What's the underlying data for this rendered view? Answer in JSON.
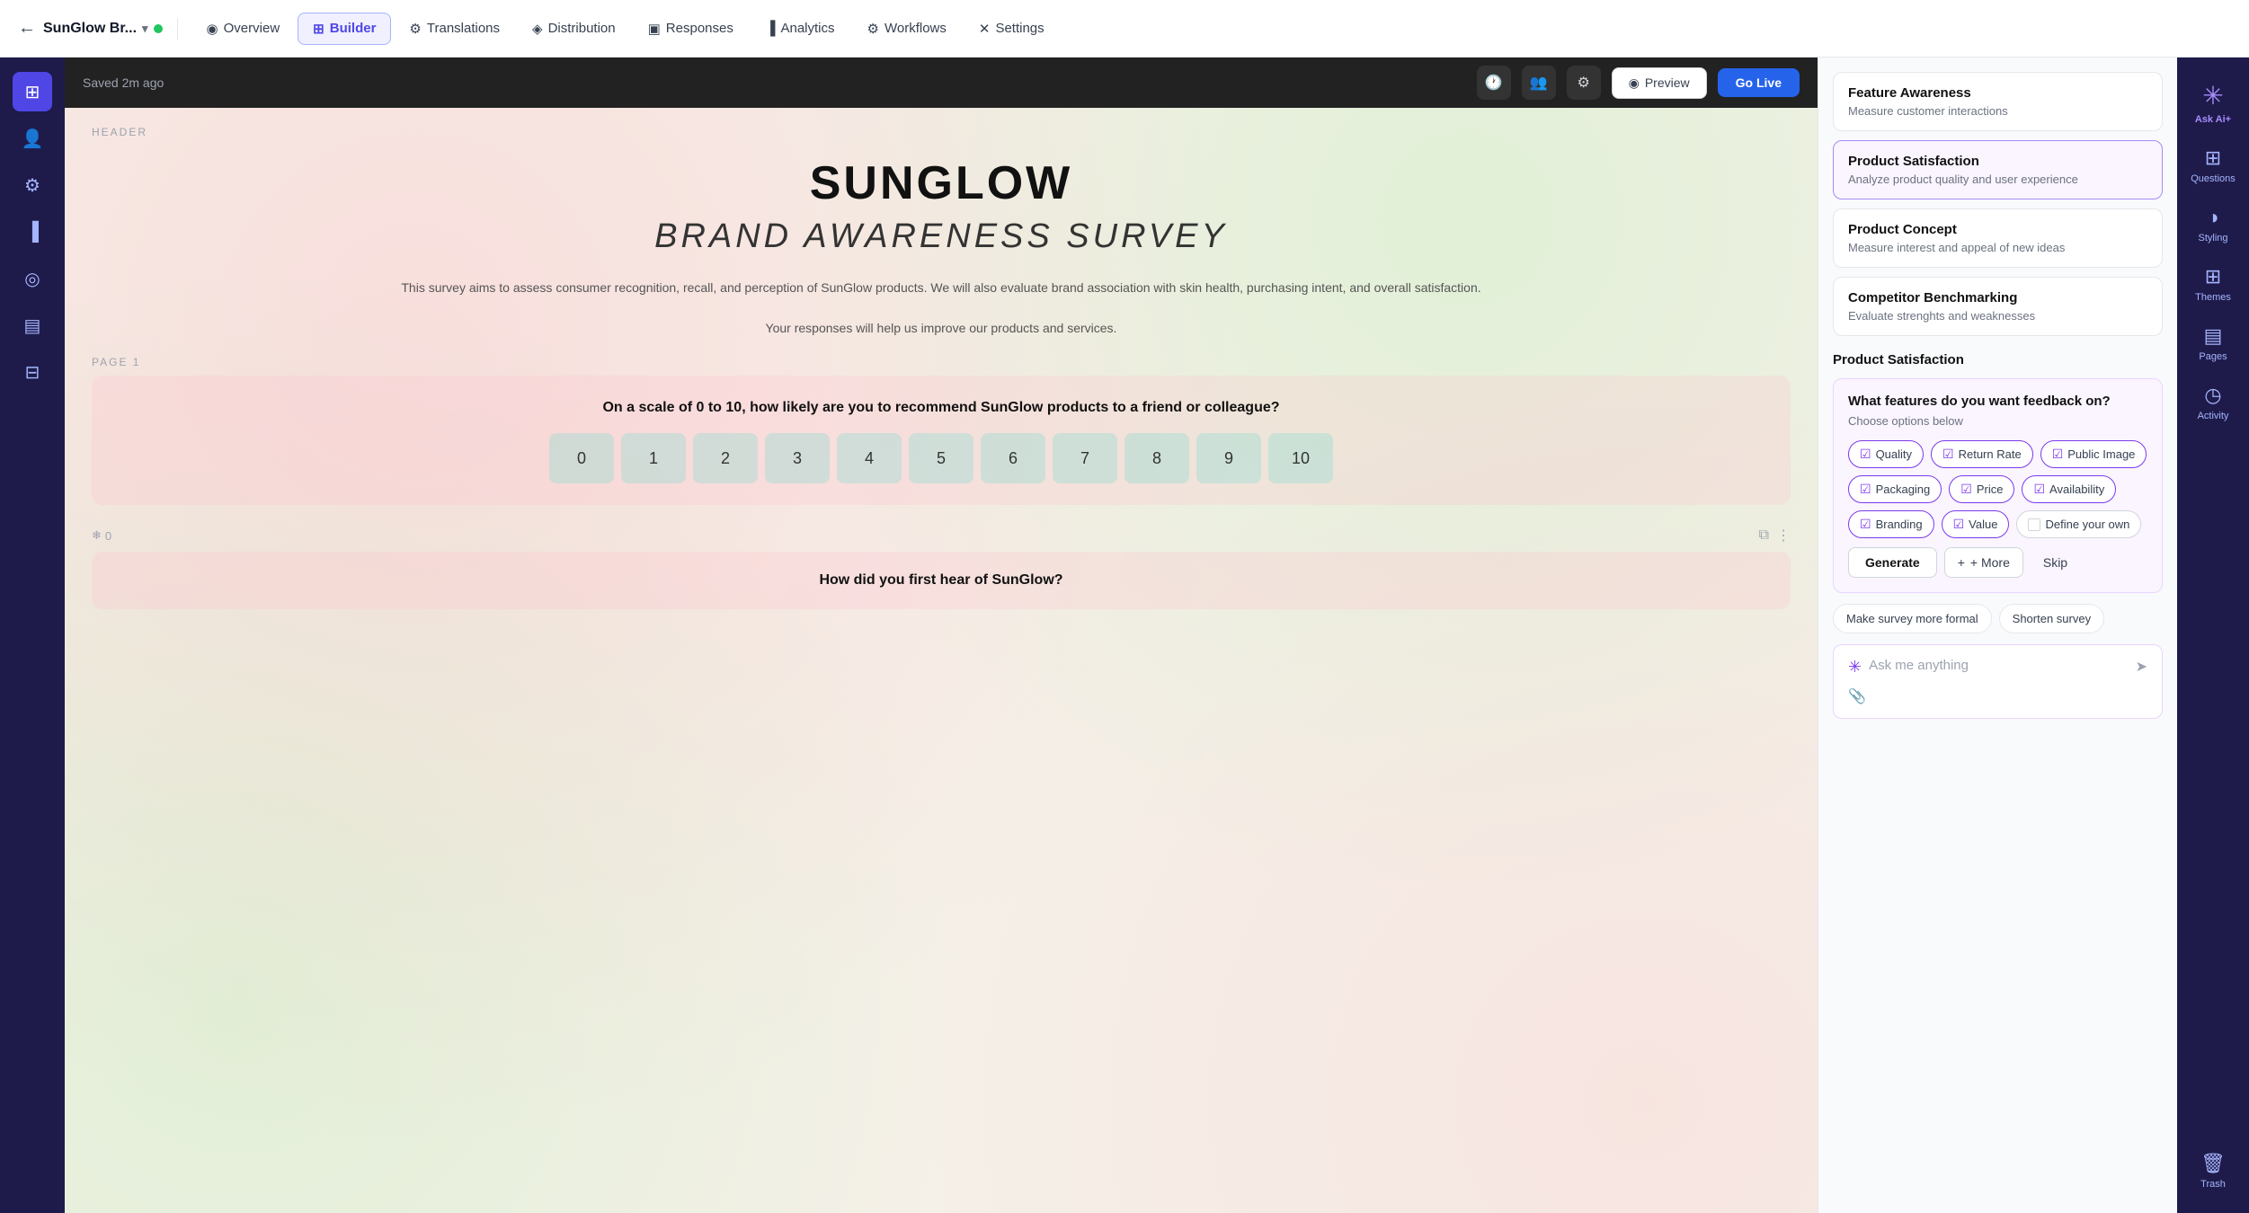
{
  "app": {
    "brand_name": "SunGlow Br...",
    "status_dot_color": "#22c55e",
    "saved_text": "Saved 2m ago"
  },
  "top_nav": {
    "back_label": "←",
    "tabs": [
      {
        "id": "overview",
        "label": "Overview",
        "icon": "◉",
        "active": false
      },
      {
        "id": "builder",
        "label": "Builder",
        "icon": "⊞",
        "active": true
      },
      {
        "id": "translations",
        "label": "Translations",
        "icon": "⚙",
        "active": false
      },
      {
        "id": "distribution",
        "label": "Distribution",
        "icon": "◈",
        "active": false
      },
      {
        "id": "responses",
        "label": "Responses",
        "icon": "▣",
        "active": false
      },
      {
        "id": "analytics",
        "label": "Analytics",
        "icon": "▐",
        "active": false
      },
      {
        "id": "workflows",
        "label": "Workflows",
        "icon": "⚙",
        "active": false
      },
      {
        "id": "settings",
        "label": "Settings",
        "icon": "✕",
        "active": false
      }
    ],
    "preview_label": "Preview",
    "golive_label": "Go Live"
  },
  "left_sidebar": {
    "icons": [
      {
        "id": "home",
        "symbol": "⊞",
        "active": true
      },
      {
        "id": "user",
        "symbol": "👤",
        "active": false
      },
      {
        "id": "settings",
        "symbol": "⚙",
        "active": false
      },
      {
        "id": "chart",
        "symbol": "▐",
        "active": false
      },
      {
        "id": "record",
        "symbol": "◎",
        "active": false
      },
      {
        "id": "doc",
        "symbol": "▤",
        "active": false
      },
      {
        "id": "inbox",
        "symbol": "⊟",
        "active": false
      }
    ]
  },
  "survey": {
    "header_label": "HEADER",
    "title_line1": "SUNGLOW",
    "title_line2": "BRAND AWARENESS SURVEY",
    "description": "This survey aims to assess consumer recognition, recall, and perception of SunGlow products. We will also evaluate brand association with skin health, purchasing intent, and overall satisfaction.",
    "description2": "Your responses will help us improve our products and services.",
    "page_label": "PAGE 1",
    "question1": "On a scale of 0 to 10, how likely are you to recommend SunGlow products to a friend or colleague?",
    "nps_values": [
      "0",
      "1",
      "2",
      "3",
      "4",
      "5",
      "6",
      "7",
      "8",
      "9",
      "10"
    ],
    "score_label": "0",
    "question2": "How did you first hear of SunGlow?"
  },
  "right_panel": {
    "survey_types": [
      {
        "id": "feature-awareness",
        "title": "Feature Awareness",
        "desc": "Measure customer interactions",
        "active": false
      },
      {
        "id": "product-satisfaction",
        "title": "Product Satisfaction",
        "desc": "Analyze product quality and user experience",
        "active": true
      },
      {
        "id": "product-concept",
        "title": "Product Concept",
        "desc": "Measure interest and appeal of new ideas",
        "active": false
      },
      {
        "id": "competitor-benchmarking",
        "title": "Competitor Benchmarking",
        "desc": "Evaluate strenghts and weaknesses",
        "active": false
      }
    ],
    "ai_section_title": "Product Satisfaction",
    "ai_card": {
      "title": "What features do you want feedback on?",
      "subtitle": "Choose options below",
      "chips": [
        {
          "label": "Quality",
          "checked": true
        },
        {
          "label": "Return Rate",
          "checked": true
        },
        {
          "label": "Public Image",
          "checked": true
        },
        {
          "label": "Packaging",
          "checked": true
        },
        {
          "label": "Price",
          "checked": true
        },
        {
          "label": "Availability",
          "checked": true
        },
        {
          "label": "Branding",
          "checked": true
        },
        {
          "label": "Value",
          "checked": true
        },
        {
          "label": "Define your own",
          "checked": false
        }
      ],
      "generate_label": "Generate",
      "more_label": "+ More",
      "skip_label": "Skip"
    },
    "suggestions": [
      {
        "label": "Make survey more formal"
      },
      {
        "label": "Shorten survey"
      }
    ],
    "ai_chat_placeholder": "Ask me anything"
  },
  "far_right_sidebar": {
    "items": [
      {
        "id": "ask-ai",
        "icon": "✳",
        "label": "Ask Ai+",
        "active": false
      },
      {
        "id": "questions",
        "icon": "⊞",
        "label": "Questions",
        "active": false
      },
      {
        "id": "styling",
        "icon": "◑",
        "label": "Styling",
        "active": false
      },
      {
        "id": "themes",
        "icon": "⊞",
        "label": "Themes",
        "active": false
      },
      {
        "id": "pages",
        "icon": "▤",
        "label": "Pages",
        "active": false
      },
      {
        "id": "activity",
        "icon": "◷",
        "label": "Activity",
        "active": false
      },
      {
        "id": "trash",
        "icon": "🗑",
        "label": "Trash",
        "active": false
      }
    ]
  }
}
